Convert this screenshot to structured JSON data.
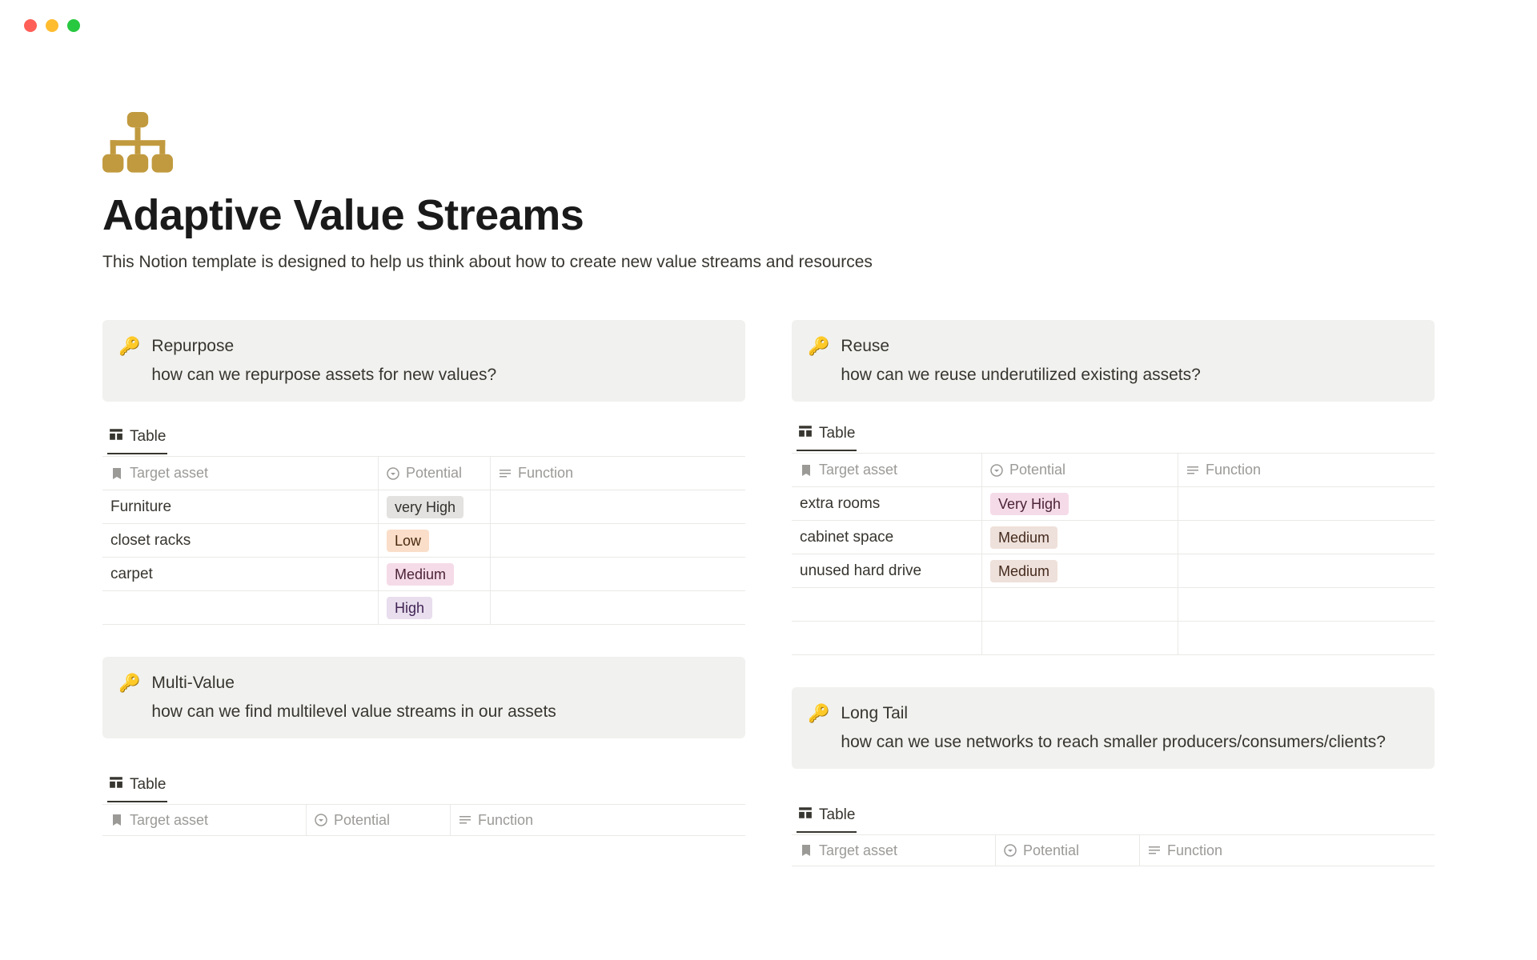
{
  "window": {
    "red": "",
    "yellow": "",
    "green": ""
  },
  "page": {
    "title": "Adaptive Value Streams",
    "subtitle": "This Notion template is designed to help us think about how to create new value streams and resources"
  },
  "tabs": {
    "table_label": "Table"
  },
  "columns": {
    "target_asset": "Target asset",
    "potential": "Potential",
    "function": "Function"
  },
  "sections": {
    "repurpose": {
      "title": "Repurpose",
      "subtitle": "how can we repurpose assets for new values?",
      "rows": [
        {
          "asset": "Furniture",
          "potential": "very High",
          "potential_class": "tag-gray"
        },
        {
          "asset": "closet racks",
          "potential": "Low",
          "potential_class": "tag-orange"
        },
        {
          "asset": "carpet",
          "potential": "Medium",
          "potential_class": "tag-pink"
        },
        {
          "asset": "",
          "potential": "High",
          "potential_class": "tag-purple"
        }
      ]
    },
    "reuse": {
      "title": "Reuse",
      "subtitle": "how can we reuse underutilized existing assets?",
      "rows": [
        {
          "asset": "extra rooms",
          "potential": "Very High",
          "potential_class": "tag-pink"
        },
        {
          "asset": "cabinet space",
          "potential": "Medium",
          "potential_class": "tag-brown"
        },
        {
          "asset": "unused hard drive",
          "potential": "Medium",
          "potential_class": "tag-brown"
        },
        {
          "asset": "",
          "potential": "",
          "potential_class": ""
        },
        {
          "asset": "",
          "potential": "",
          "potential_class": ""
        }
      ]
    },
    "multivalue": {
      "title": "Multi-Value",
      "subtitle": "how can we find multilevel value streams in our assets"
    },
    "longtail": {
      "title": "Long Tail",
      "subtitle": "how can we use networks to reach smaller producers/consumers/clients?"
    }
  }
}
